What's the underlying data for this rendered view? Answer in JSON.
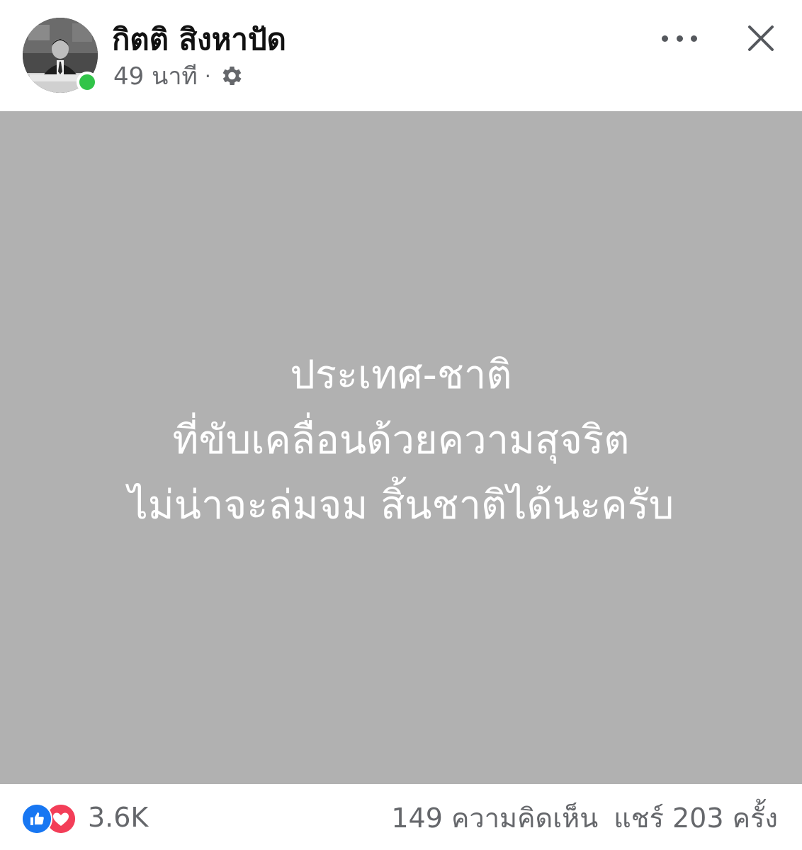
{
  "header": {
    "author_name": "กิตติ สิงหาปัด",
    "timestamp": "49 นาที",
    "separator": "·",
    "privacy_icon": "gear-icon",
    "more_icon": "more-horizontal-icon",
    "close_icon": "close-icon",
    "online_status_color": "#31c449"
  },
  "post": {
    "background_color": "#b1b1b1",
    "text_color": "#ffffff",
    "lines": [
      "ประเทศ-ชาติ",
      "ที่ขับเคลื่อนด้วยความสุจริต",
      "ไม่น่าจะล่มจม สิ้นชาติได้นะครับ"
    ]
  },
  "footer": {
    "reaction_icons": [
      "like-icon",
      "love-icon"
    ],
    "reaction_count": "3.6K",
    "comments": "149 ความคิดเห็น",
    "shares": "แชร์ 203 ครั้ง",
    "like_color": "#1877f2",
    "love_color": "#f33e58"
  }
}
